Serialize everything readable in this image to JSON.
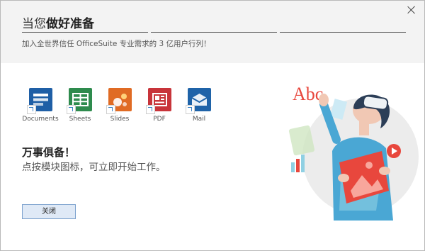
{
  "header": {
    "title_light": "当您",
    "title_bold": "做好准备",
    "subtitle": "加入全世界信任 OfficeSuite 专业需求的 3 亿用户行列！"
  },
  "apps": [
    {
      "label": "Documents",
      "icon": "documents-icon",
      "color": "#1f5fa6"
    },
    {
      "label": "Sheets",
      "icon": "sheets-icon",
      "color": "#2e8b4d"
    },
    {
      "label": "Slides",
      "icon": "slides-icon",
      "color": "#e06b24"
    },
    {
      "label": "PDF",
      "icon": "pdf-icon",
      "color": "#c8343a"
    },
    {
      "label": "Mail",
      "icon": "mail-icon",
      "color": "#1f63a8"
    }
  ],
  "ready": {
    "heading": "万事俱备！",
    "description": "点按模块图标，可立即开始工作。"
  },
  "buttons": {
    "close_label": "关闭"
  },
  "illustration": {
    "text": "Abc",
    "accent": "#e8473d"
  }
}
